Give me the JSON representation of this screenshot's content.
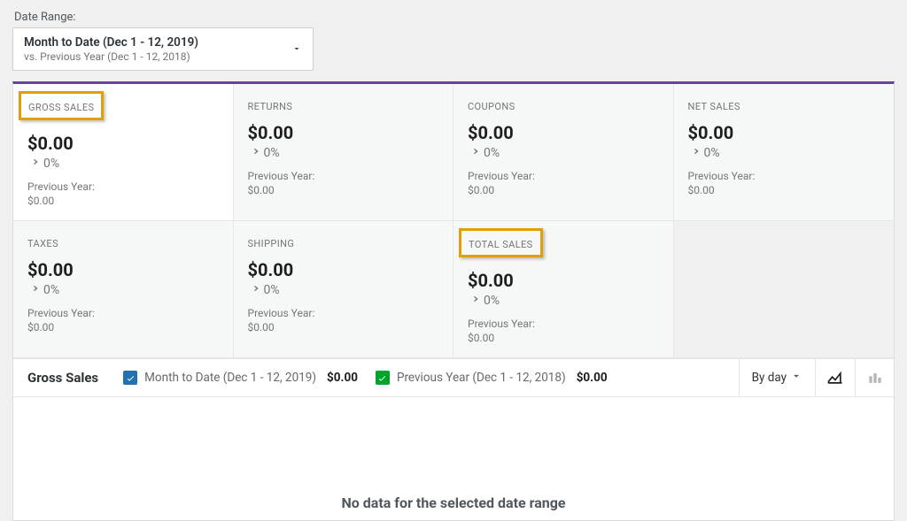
{
  "dateRange": {
    "label": "Date Range:",
    "main": "Month to Date (Dec 1 - 12, 2019)",
    "sub": "vs. Previous Year (Dec 1 - 12, 2018)"
  },
  "metrics": {
    "compareLabel": "Previous Year:",
    "cards": [
      {
        "title": "GROSS SALES",
        "value": "$0.00",
        "change": "0%",
        "prev": "$0.00",
        "highlighted": true,
        "active": true
      },
      {
        "title": "RETURNS",
        "value": "$0.00",
        "change": "0%",
        "prev": "$0.00",
        "highlighted": false,
        "active": false
      },
      {
        "title": "COUPONS",
        "value": "$0.00",
        "change": "0%",
        "prev": "$0.00",
        "highlighted": false,
        "active": false
      },
      {
        "title": "NET SALES",
        "value": "$0.00",
        "change": "0%",
        "prev": "$0.00",
        "highlighted": false,
        "active": false
      },
      {
        "title": "TAXES",
        "value": "$0.00",
        "change": "0%",
        "prev": "$0.00",
        "highlighted": false,
        "active": false
      },
      {
        "title": "SHIPPING",
        "value": "$0.00",
        "change": "0%",
        "prev": "$0.00",
        "highlighted": false,
        "active": false
      },
      {
        "title": "TOTAL SALES",
        "value": "$0.00",
        "change": "0%",
        "prev": "$0.00",
        "highlighted": true,
        "active": false
      }
    ]
  },
  "chart": {
    "title": "Gross Sales",
    "series": [
      {
        "label": "Month to Date (Dec 1 - 12, 2019)",
        "value": "$0.00",
        "color": "blue"
      },
      {
        "label": "Previous Year (Dec 1 - 12, 2018)",
        "value": "$0.00",
        "color": "green"
      }
    ],
    "interval": "By day",
    "empty": "No data for the selected date range"
  },
  "chart_data": {
    "type": "line",
    "title": "Gross Sales",
    "xlabel": "",
    "ylabel": "",
    "series": [
      {
        "name": "Month to Date (Dec 1 - 12, 2019)",
        "values": []
      },
      {
        "name": "Previous Year (Dec 1 - 12, 2018)",
        "values": []
      }
    ],
    "categories": [],
    "note": "No data for the selected date range"
  }
}
